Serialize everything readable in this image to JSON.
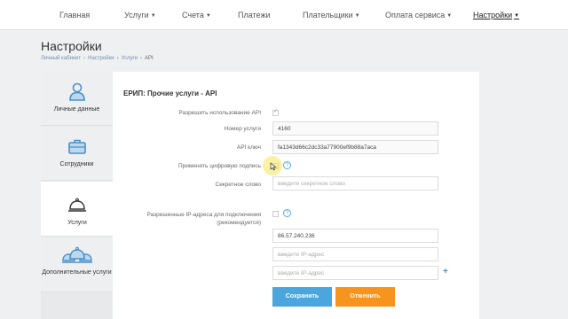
{
  "nav": {
    "items": [
      {
        "label": "Главная",
        "dropdown": false,
        "active": false
      },
      {
        "label": "Услуги",
        "dropdown": true,
        "active": false
      },
      {
        "label": "Счета",
        "dropdown": true,
        "active": false
      },
      {
        "label": "Платежи",
        "dropdown": false,
        "active": false
      },
      {
        "label": "Плательщики",
        "dropdown": true,
        "active": false
      },
      {
        "label": "Оплата сервиса",
        "dropdown": true,
        "active": false
      },
      {
        "label": "Настройки",
        "dropdown": true,
        "active": true
      }
    ]
  },
  "page": {
    "title": "Настройки",
    "breadcrumb": [
      "Личный кабинет",
      "Настройки",
      "Услуги",
      "API"
    ]
  },
  "sidebar": {
    "items": [
      {
        "label": "Личные данные",
        "icon": "user-icon"
      },
      {
        "label": "Сотрудники",
        "icon": "briefcase-icon"
      },
      {
        "label": "Услуги",
        "icon": "service-bell-icon",
        "active": true
      },
      {
        "label": "Дополнительные услуги",
        "icon": "service-bells-icon"
      }
    ]
  },
  "form": {
    "title": "ЕРИП: Прочие услуги - API",
    "allow_api_label": "Разрешить использование API",
    "allow_api_checked": true,
    "service_number_label": "Номер услуги",
    "service_number_value": "4160",
    "api_key_label": "API ключ",
    "api_key_value": "fa1343d66c2dc33a77900ef9b88a7aca",
    "digital_signature_label": "Применять цифровую подпись",
    "digital_signature_checked": false,
    "secret_word_label": "Секретное слово",
    "secret_word_placeholder": "введите секретное слово",
    "allowed_ip_label": "Разрешенные IP-адреса для подключения",
    "allowed_ip_sublabel": "(рекомендуется)",
    "allowed_ip_checked": false,
    "ip_addresses": [
      "86.57.240.236",
      "",
      ""
    ],
    "ip_placeholder": "введите IP-адрес",
    "save_label": "Сохранить",
    "cancel_label": "Отменить"
  },
  "colors": {
    "save_button": "#4aa6dc",
    "cancel_button": "#f7941d",
    "accent_icon": "#4a90c8"
  }
}
